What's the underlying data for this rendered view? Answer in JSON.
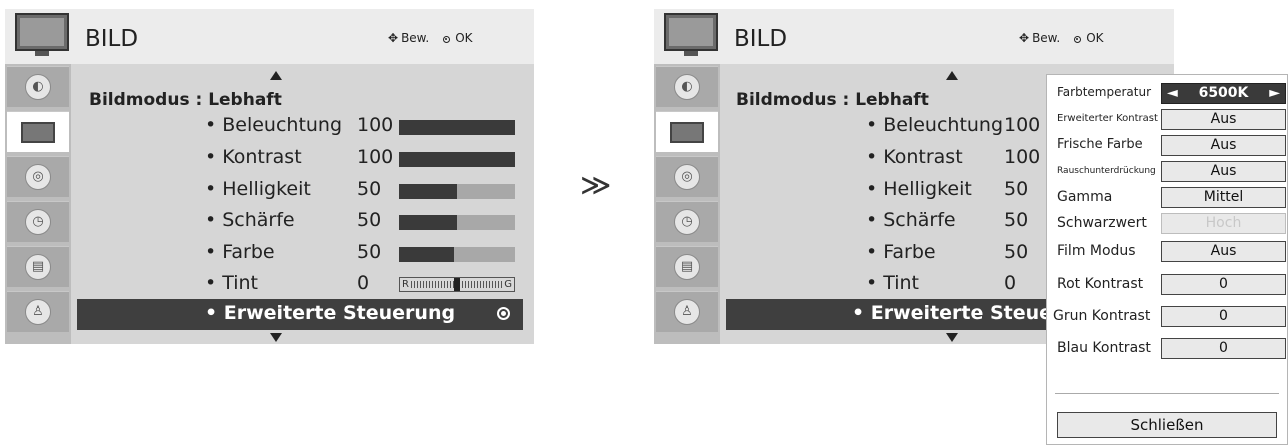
{
  "left_menu": {
    "title": "BILD",
    "hint_move": "Bew.",
    "hint_ok": "OK",
    "mode_label": "Bildmodus : Lebhaft",
    "items": [
      {
        "label": "Beleuchtung",
        "value": "100",
        "level": 1.0
      },
      {
        "label": "Kontrast",
        "value": "100",
        "level": 1.0
      },
      {
        "label": "Helligkeit",
        "value": "50",
        "level": 0.5
      },
      {
        "label": "Schärfe",
        "value": "50",
        "level": 0.5
      },
      {
        "label": "Farbe",
        "value": "50",
        "level": 0.5
      },
      {
        "label": "Tint",
        "value": "0"
      }
    ],
    "tint_left": "R",
    "tint_right": "G",
    "selected": "Erweiterte Steuerung"
  },
  "right_menu": {
    "title": "BILD",
    "hint_move": "Bew.",
    "hint_ok": "OK",
    "mode_label": "Bildmodus : Lebhaft",
    "items": [
      {
        "label": "Beleuchtung",
        "value": "100"
      },
      {
        "label": "Kontrast",
        "value": "100"
      },
      {
        "label": "Helligkeit",
        "value": "50"
      },
      {
        "label": "Schärfe",
        "value": "50"
      },
      {
        "label": "Farbe",
        "value": "50"
      },
      {
        "label": "Tint",
        "value": "0"
      }
    ],
    "selected": "Erweiterte Steuerung"
  },
  "transition_symbol": "≫",
  "popup": {
    "rows": [
      {
        "label": "Farbtemperatur",
        "value": "6500K"
      },
      {
        "label": "Erweiterter Kontrast",
        "value": "Aus"
      },
      {
        "label": "Frische Farbe",
        "value": "Aus"
      },
      {
        "label": "Rauschunterdrückung",
        "value": "Aus"
      },
      {
        "label": "Gamma",
        "value": "Mittel"
      },
      {
        "label": "Schwarzwert",
        "value": "Hoch"
      },
      {
        "label": "Film Modus",
        "value": "Aus"
      },
      {
        "label": "Rot Kontrast",
        "value": "0"
      },
      {
        "label": "Grun Kontrast",
        "value": "0"
      },
      {
        "label": "Blau Kontrast",
        "value": "0"
      }
    ],
    "close_label": "Schließen"
  },
  "sidebar_icons": [
    "picture-icon",
    "tv-icon",
    "speaker-icon",
    "clock-icon",
    "option-icon",
    "lock-icon"
  ]
}
